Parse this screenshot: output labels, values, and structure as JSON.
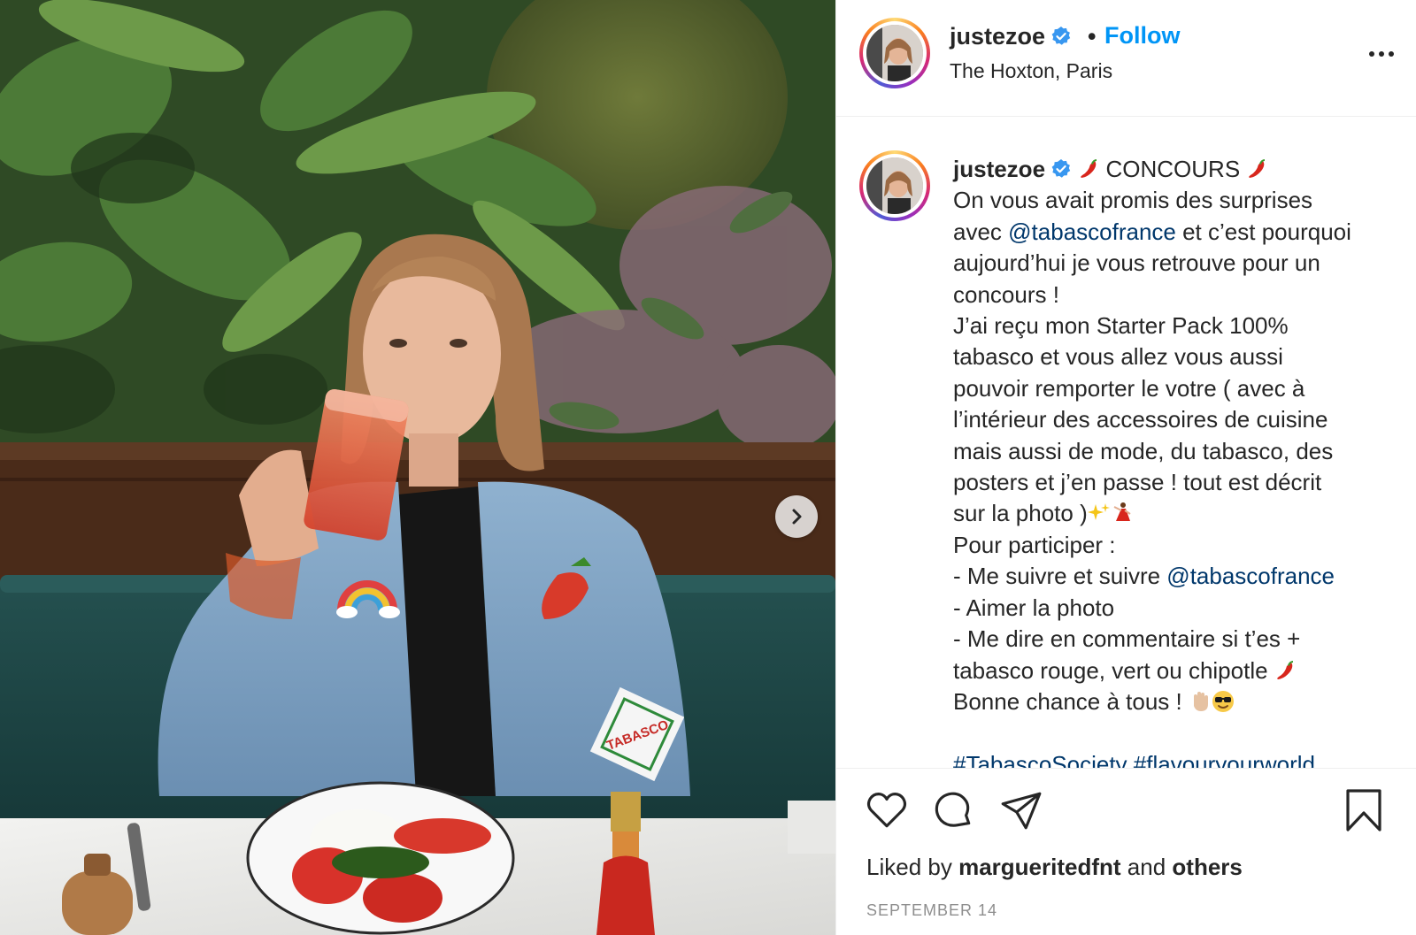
{
  "post": {
    "username": "justezoe",
    "follow_label": "Follow",
    "separator": "•",
    "location": "The Hoxton, Paris"
  },
  "caption": {
    "username": "justezoe",
    "title": "CONCOURS",
    "lines": {
      "l1": "On vous avait promis des surprises",
      "l2_pre": "avec ",
      "l2_mention": "@tabascofrance",
      "l2_post": " et c’est pourquoi",
      "l3": "aujourd’hui je vous retrouve pour un",
      "l4": "concours !",
      "l5": "J’ai reçu mon Starter Pack 100%",
      "l6": "tabasco et vous allez vous aussi",
      "l7": "pouvoir remporter le votre ( avec à",
      "l8": "l’intérieur des accessoires de cuisine",
      "l9": "mais aussi de mode, du tabasco, des",
      "l10": "posters et j’en passe ! tout est décrit",
      "l11": "sur la photo )",
      "l12": "Pour participer :",
      "l13_pre": "- Me suivre et suivre ",
      "l13_mention": "@tabascofrance",
      "l14": "- Aimer la photo",
      "l15": "- Me dire en commentaire si t’es +",
      "l16": "tabasco rouge, vert ou chipotle",
      "l17": "Bonne chance à tous !",
      "hashtags": "#TabascoSociety #flavouryourworld"
    }
  },
  "actions": {
    "liked_by_prefix": "Liked by",
    "liked_by_user": "margueritedfnt",
    "and": "and",
    "others": "others",
    "date": "SEPTEMBER 14"
  },
  "icons": {
    "verified": "verified-badge-icon",
    "more": "more-options-icon",
    "like": "heart-icon",
    "comment": "comment-icon",
    "share": "paper-plane-icon",
    "save": "bookmark-icon",
    "next": "chevron-right-icon"
  },
  "colors": {
    "link_blue": "#0095f6",
    "mention": "#00376b",
    "verified": "#3897f0",
    "text": "#262626",
    "muted": "#8e8e8e"
  },
  "photo": {
    "label": "TABASCO"
  }
}
